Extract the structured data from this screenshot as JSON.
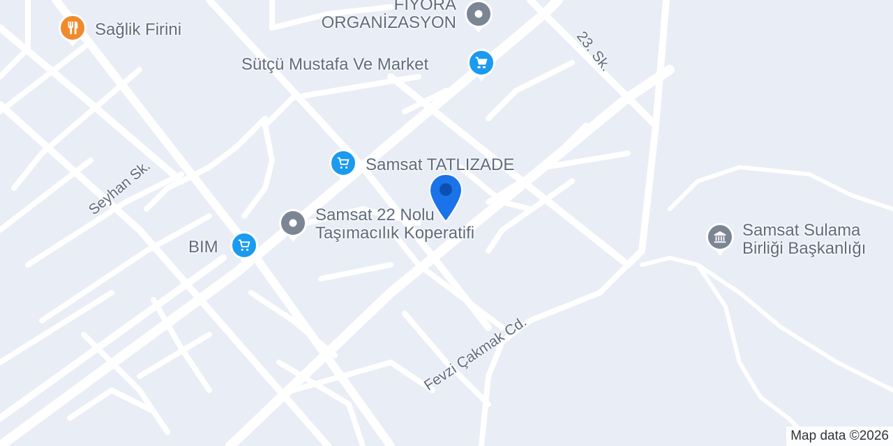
{
  "map": {
    "attribution": "Map data ©2026",
    "colors": {
      "background": "#e9edf5",
      "road": "#ffffff",
      "label_text": "#5f6b7c",
      "food_poi": "#f08a2c",
      "shopping_poi": "#1a9af0",
      "generic_poi": "#7c8593",
      "pin": "#1a73e8"
    },
    "places": {
      "saglik_firini": {
        "name": "Sağlik Firini",
        "icon": "restaurant-icon"
      },
      "fiyora": {
        "line1": "FİYORA",
        "line2": "ORGANİZASYON",
        "icon": "place-icon"
      },
      "sutcu": {
        "name": "Sütçü Mustafa Ve Market",
        "icon": "shopping-cart-icon"
      },
      "tatlizade": {
        "name": "Samsat TATLIZADE",
        "icon": "shopping-cart-icon"
      },
      "koperatif": {
        "line1": "Samsat 22 Nolu",
        "line2": "Taşımacılık Koperatifi",
        "icon": "place-icon"
      },
      "bim": {
        "name": "BIM",
        "icon": "shopping-cart-icon"
      },
      "sulama": {
        "line1": "Samsat Sulama",
        "line2": "Birliği Başkanlığı",
        "icon": "government-building-icon"
      }
    },
    "streets": {
      "seyhan": "Seyhan Sk.",
      "sk23": "23. Sk.",
      "fevzi": "Fevzi Çakmak Cd."
    }
  }
}
